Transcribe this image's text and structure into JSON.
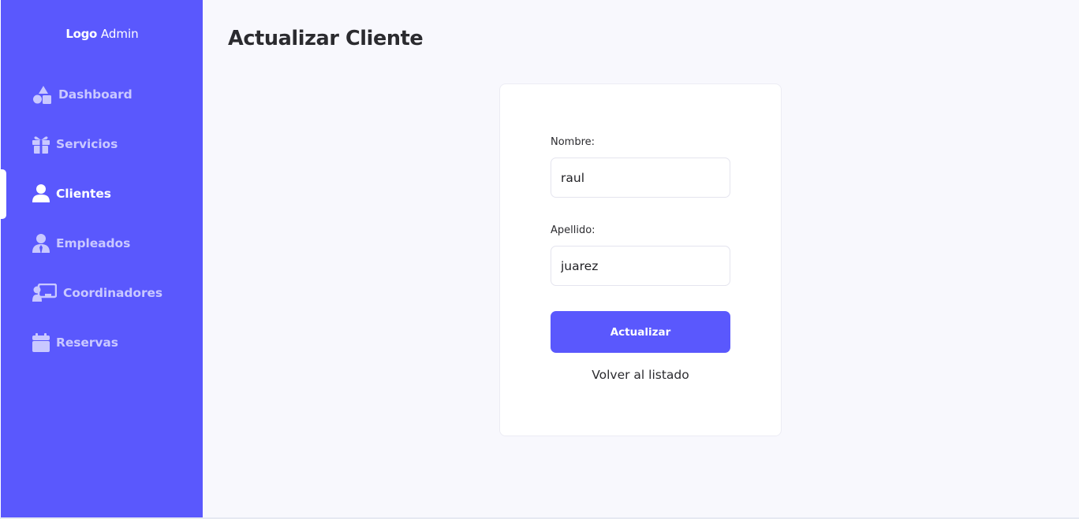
{
  "sidebar": {
    "logo_bold": "Logo",
    "logo_text": "Admin",
    "items": [
      {
        "label": "Dashboard",
        "icon": "shapes-icon",
        "active": false
      },
      {
        "label": "Servicios",
        "icon": "gift-icon",
        "active": false
      },
      {
        "label": "Clientes",
        "icon": "user-icon",
        "active": true
      },
      {
        "label": "Empleados",
        "icon": "user-tie-icon",
        "active": false
      },
      {
        "label": "Coordinadores",
        "icon": "chalkboard-user-icon",
        "active": false
      },
      {
        "label": "Reservas",
        "icon": "calendar-icon",
        "active": false
      }
    ]
  },
  "main": {
    "title": "Actualizar Cliente"
  },
  "form": {
    "nombre_label": "Nombre:",
    "nombre_value": "raul",
    "apellido_label": "Apellido:",
    "apellido_value": "juarez",
    "submit_label": "Actualizar",
    "back_label": "Volver al listado"
  },
  "colors": {
    "accent": "#5a58fd",
    "nav_inactive": "#c9c8ff",
    "background": "#f8f8fd"
  }
}
